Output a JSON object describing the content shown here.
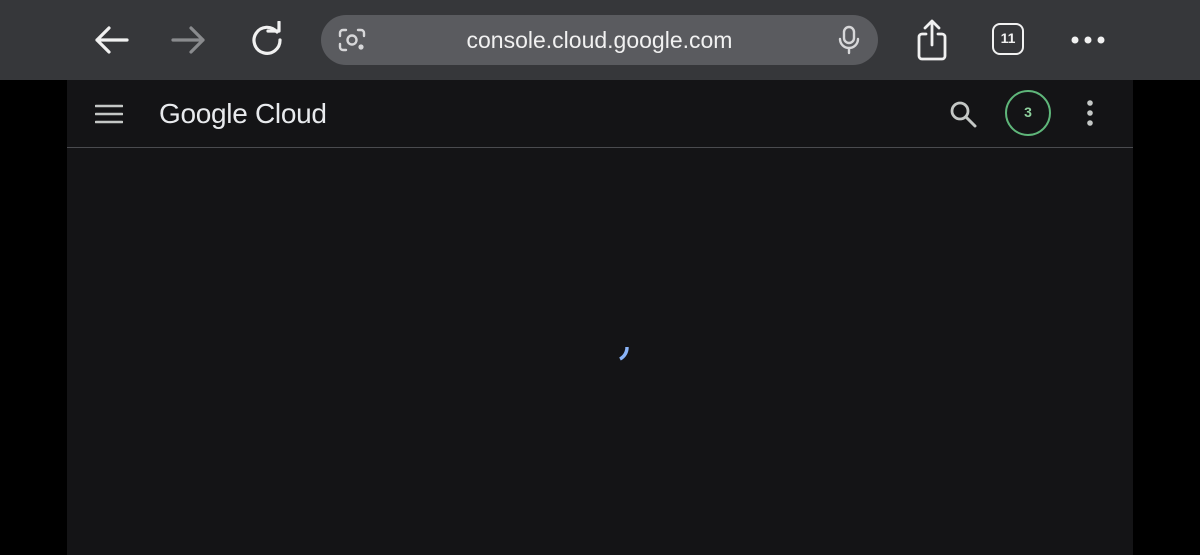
{
  "browser": {
    "url": "console.cloud.google.com",
    "tab_count": "11",
    "icons": {
      "back": "back-arrow-icon",
      "forward": "forward-arrow-icon",
      "reload": "reload-icon",
      "lens": "lens-camera-icon",
      "mic": "microphone-icon",
      "share": "share-icon",
      "more": "more-dots-icon"
    }
  },
  "console": {
    "logo_word_1": "Google",
    "logo_word_2": "Cloud",
    "notification_count": "3",
    "icons": {
      "menu": "hamburger-menu-icon",
      "search": "search-icon",
      "overflow": "vertical-dots-icon",
      "loading": "loading-spinner-icon"
    }
  },
  "colors": {
    "toolbar_bg": "#36373a",
    "omnibox_bg": "#5a5b5f",
    "page_bg": "#141416",
    "badge_ring": "#5fb67a",
    "spinner": "#8ab4f8"
  }
}
